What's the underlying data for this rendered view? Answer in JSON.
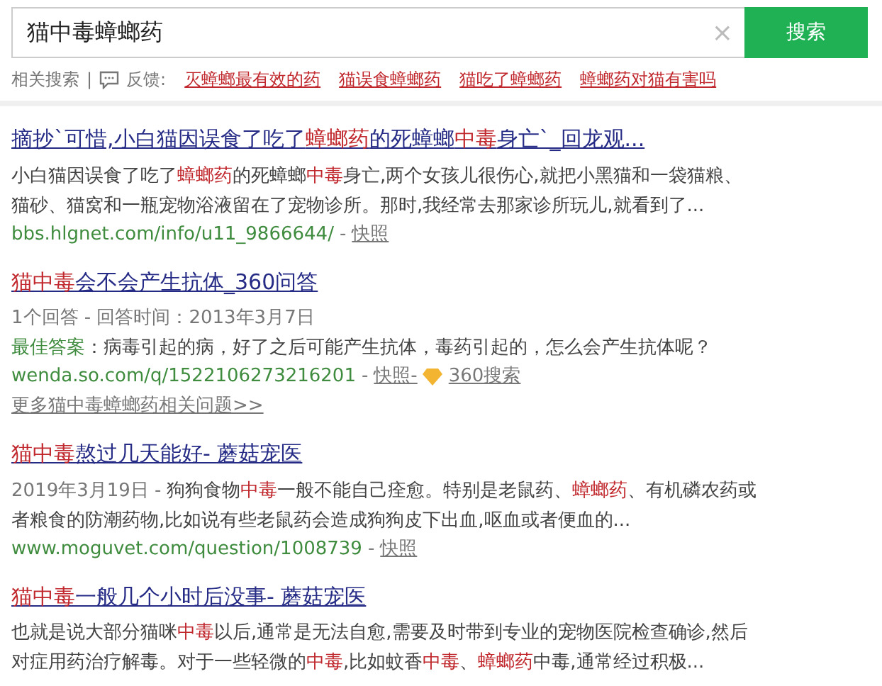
{
  "search": {
    "value": "猫中毒蟑螂药",
    "button": "搜索",
    "clear": "×"
  },
  "related": {
    "label": "相关搜索",
    "separator": "|",
    "feedback": "反馈:",
    "items": [
      "灭蟑螂最有效的药",
      "猫误食蟑螂药",
      "猫吃了蟑螂药",
      "蟑螂药对猫有害吗"
    ]
  },
  "results": [
    {
      "kind": "web",
      "title": "摘抄`可惜,小白猫因误食了吃了**蟑螂药**的死蟑螂**中毒**身亡`_回龙观...",
      "snippet": "小白猫因误食了吃了**蟑螂药**的死蟑螂**中毒**身亡,两个女孩儿很伤心,就把小黑猫和一袋猫粮、猫砂、猫窝和一瓶宠物浴液留在了宠物诊所。那时,我经常去那家诊所玩儿,就看到了...",
      "url": "bbs.hlgnet.com/info/u11_9866644/",
      "sep": "-",
      "cache": "快照"
    },
    {
      "kind": "qa",
      "title": "**猫中毒**会不会产生抗体_360问答",
      "meta": "1个回答 - 回答时间：2013年3月7日",
      "answer_label": "最佳答案",
      "answer": "：病毒引起的病，好了之后可能产生抗体，毒药引起的，怎么会产生抗体呢？",
      "url": "wenda.so.com/q/1522106273216201",
      "sep": "-",
      "cache": "快照-",
      "source": "360搜索",
      "more": "更多猫中毒蟑螂药相关问题>>"
    },
    {
      "kind": "web",
      "title": "**猫中毒**熬过几天能好- 蘑菇宠医",
      "date": "2019年3月19日 -",
      "snippet": "狗狗食物**中毒**一般不能自己痊愈。特别是老鼠药、**蟑螂药**、有机磷农药或者粮食的防潮药物,比如说有些老鼠药会造成狗狗皮下出血,呕血或者便血的...",
      "url": "www.moguvet.com/question/1008739",
      "sep": "-",
      "cache": "快照"
    },
    {
      "kind": "web",
      "title": "**猫中毒**一般几个小时后没事- 蘑菇宠医",
      "snippet": "也就是说大部分猫咪**中毒**以后,通常是无法自愈,需要及时带到专业的宠物医院检查确诊,然后对症用药治疗解毒。对于一些轻微的**中毒**,比如蚊香**中毒**、**蟑螂药**中毒,通常经过积极..."
    }
  ]
}
